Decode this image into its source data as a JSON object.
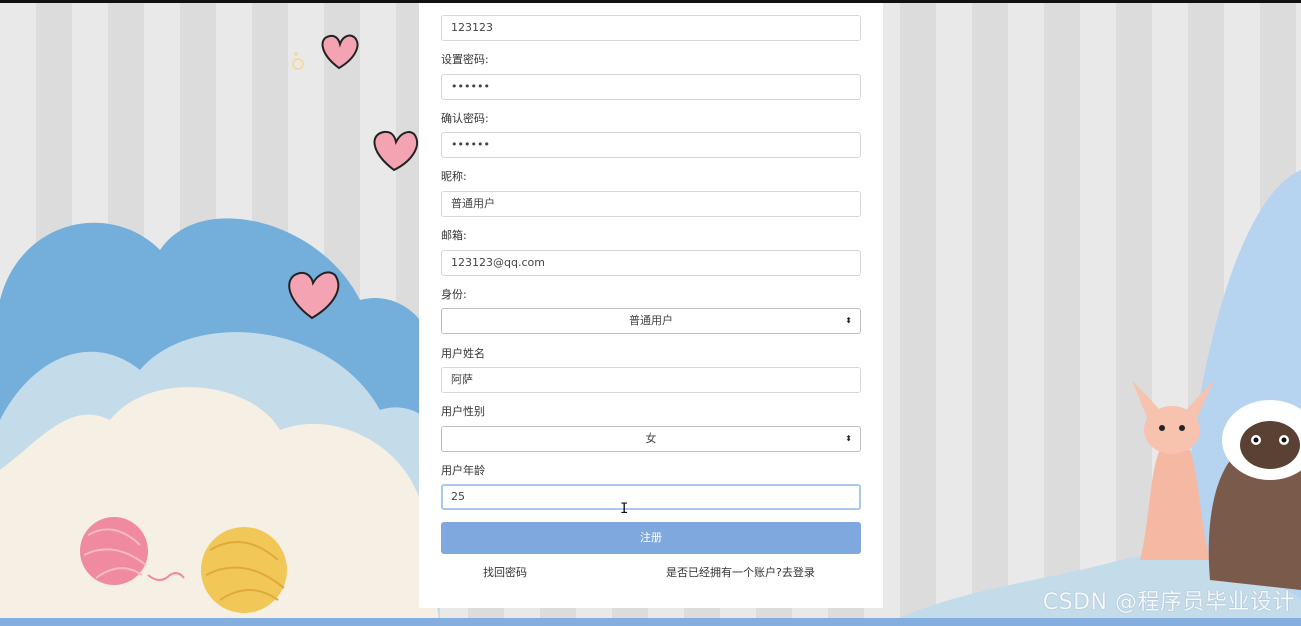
{
  "form": {
    "account_value": "123123",
    "password_label": "设置密码:",
    "password_value": "••••••",
    "confirm_label": "确认密码:",
    "confirm_value": "••••••",
    "nickname_label": "昵称:",
    "nickname_value": "普通用户",
    "email_label": "邮箱:",
    "email_value": "123123@qq.com",
    "identity_label": "身份:",
    "identity_selected": "普通用户",
    "realname_label": "用户姓名",
    "realname_value": "阿萨",
    "gender_label": "用户性别",
    "gender_selected": "女",
    "age_label": "用户年龄",
    "age_value": "25",
    "submit_label": "注册"
  },
  "links": {
    "forgot_password": "找回密码",
    "have_account": "是否已经拥有一个账户?去登录"
  },
  "watermark": "CSDN @程序员毕业设计",
  "icons": {
    "select_arrow": "⬍",
    "text_cursor": "I"
  },
  "colors": {
    "button": "#7fa9de",
    "cloud_blue": "#74aedb",
    "heart": "#f4a3b3"
  }
}
